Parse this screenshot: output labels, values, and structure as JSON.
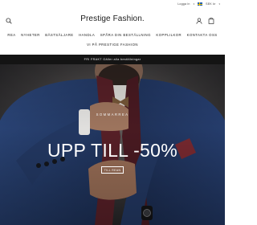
{
  "header": {
    "utility": {
      "link": "Logga in",
      "currency": "SEK kr"
    },
    "logo": "Prestige Fashion.",
    "nav": {
      "row1": [
        "REA",
        "NYHETER",
        "BÄSTSÄLJARE",
        "HANDLA",
        "SPÅRA DIN BESTÄLLNING",
        "KOPPLILKOR",
        "KONTAKTA OSS"
      ],
      "row2": [
        "VI PÅ PRESTIGE FASHION"
      ]
    }
  },
  "promo": {
    "text": "FRI FRAKT Gäller alla beställningar"
  },
  "hero": {
    "eyebrow": "SOMMARREA",
    "headline": "UPP TILL -50%",
    "cta": "TILL REAN"
  },
  "colors": {
    "strip": "#141414",
    "hero_bg": "#2b2b2e",
    "suit": "#27406f",
    "scarf": "#5b2129"
  }
}
